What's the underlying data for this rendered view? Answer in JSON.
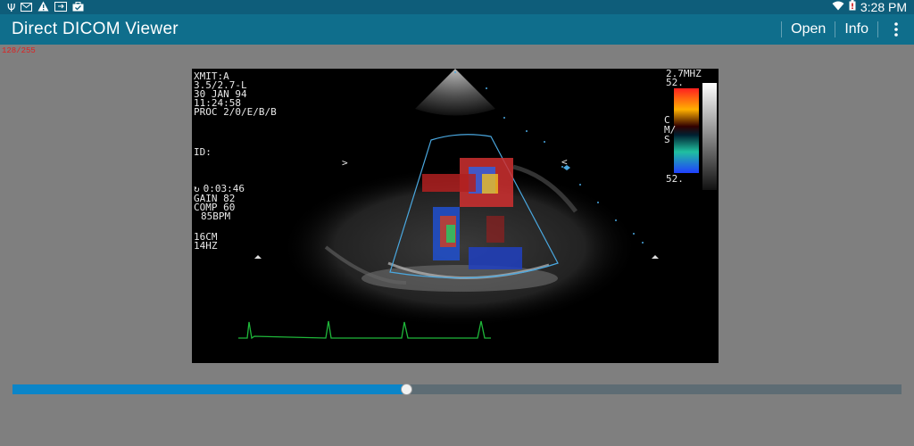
{
  "statusbar": {
    "time": "3:28 PM",
    "left_icons": [
      "usb-icon",
      "gmail-icon",
      "warning-icon",
      "screen-cast-icon",
      "briefcase-check-icon"
    ],
    "right_icons": [
      "wifi-icon",
      "battery-low-icon"
    ]
  },
  "actionbar": {
    "title": "Direct DICOM Viewer",
    "open_label": "Open",
    "info_label": "Info",
    "overflow_icon": "more-vertical-icon"
  },
  "frame_counter": "128/255",
  "image": {
    "top_left": {
      "xmit": "XMIT:A",
      "probe": "3.5/2.7-L",
      "date": "30 JAN 94",
      "time": "11:24:58",
      "proc": "PROC 2/0/E/B/B"
    },
    "id_label": "ID:",
    "params": {
      "clock": "0:03:46",
      "gain": "GAIN 82",
      "comp": "COMP 60",
      "bpm": "85BPM",
      "depth": "16CM",
      "rate": "14HZ"
    },
    "top_right": {
      "freq": "2.7MHZ",
      "scale_top": "52.",
      "unit": "CM/S",
      "scale_bottom": "52."
    },
    "markers": {
      "left_arrow": ">",
      "right_arrow": "<"
    }
  },
  "slider": {
    "position_fraction": 0.443,
    "fill_color": "#0b85c8",
    "track_color": "#5d6c74"
  },
  "colors": {
    "statusbar": "#0e5d7a",
    "actionbar": "#0f6e8c",
    "background": "#7f7f7f",
    "ecg": "#1fb83a",
    "sector_outline": "#4aa8e0"
  }
}
